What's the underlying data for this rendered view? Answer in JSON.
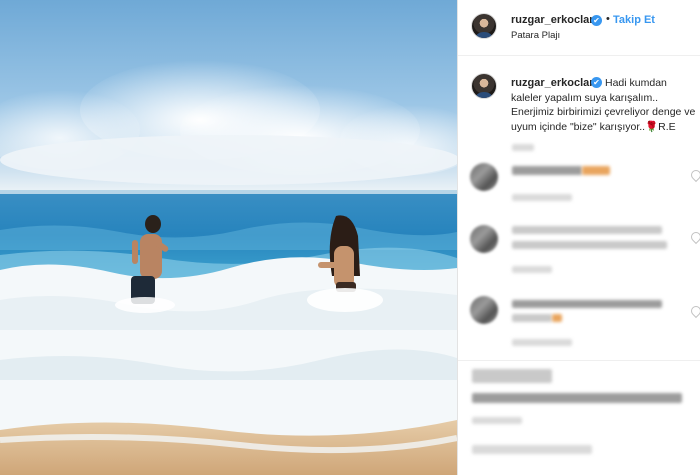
{
  "post": {
    "username": "ruzgar_erkoclar",
    "verified_mark": "✔",
    "separator": "•",
    "follow_label": "Takip Et",
    "location": "Patara Plajı"
  },
  "caption": {
    "username": "ruzgar_erkoclar",
    "verified_mark": "✔",
    "text": "Hadi kumdan kaleler yapalım suya karışalım.. Enerjimiz birbirimizi çevreliyor denge ve uyum içinde \"bize\" karışıyor..🌹R.E"
  },
  "icons": {
    "verified": "verified-badge-icon",
    "heart": "heart-icon",
    "avatar": "profile-avatar"
  },
  "colors": {
    "accent": "#3897f0",
    "text": "#262626",
    "sea": "#2a86c2",
    "sand": "#d9b48a"
  }
}
